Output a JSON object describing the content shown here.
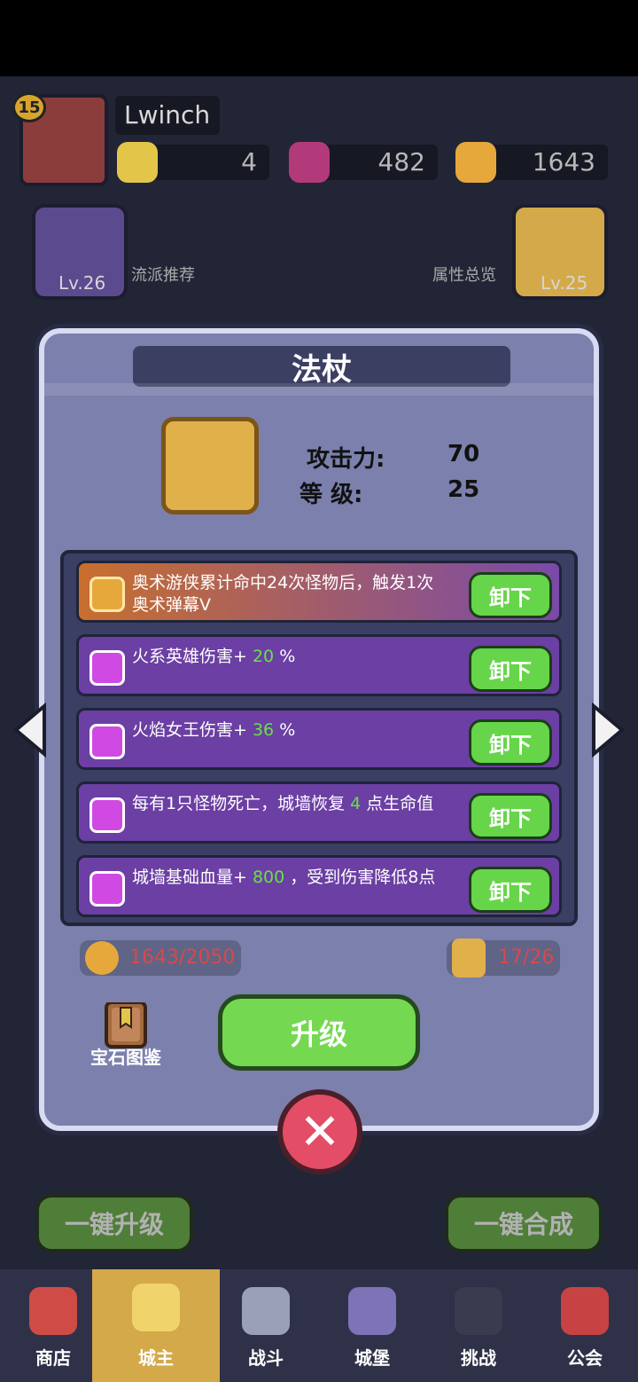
{
  "hud": {
    "level": "15",
    "player_name": "Lwinch",
    "resources": [
      {
        "icon": "gold-gem-icon",
        "value": "4"
      },
      {
        "icon": "purple-gem-icon",
        "value": "482"
      },
      {
        "icon": "coin-icon",
        "value": "1643"
      }
    ]
  },
  "side": {
    "left_card": {
      "level": "Lv.26",
      "label": "流派推荐"
    },
    "right_card": {
      "level": "Lv.25",
      "label": "属性总览"
    }
  },
  "modal": {
    "title": "法杖",
    "stats": {
      "attack_label": "攻击力:",
      "attack_value": "70",
      "level_label": "等  级:",
      "level_value": "25"
    },
    "abilities": [
      {
        "text_prefix": "奥术游侠累计命中24次怪物后，触发1次奥术弹幕V",
        "text_value": "",
        "text_suffix": "",
        "button": "卸下",
        "icon_color": "#e7a83b"
      },
      {
        "text_prefix": "火系英雄伤害+",
        "text_value": "20",
        "text_suffix": "%",
        "button": "卸下",
        "icon_color": "#d049e2"
      },
      {
        "text_prefix": "火焰女王伤害+",
        "text_value": "36",
        "text_suffix": "%",
        "button": "卸下",
        "icon_color": "#d049e2"
      },
      {
        "text_prefix": "每有1只怪物死亡，城墙恢复",
        "text_value": "4",
        "text_suffix": "点生命值",
        "button": "卸下",
        "icon_color": "#d049e2"
      },
      {
        "text_prefix": "城墙基础血量+",
        "text_value": "800",
        "text_suffix": "，受到伤害降低8点",
        "button": "卸下",
        "icon_color": "#d049e2"
      }
    ],
    "resource_left": "1643/2050",
    "resource_right": "17/26",
    "gem_book_label": "宝石图鉴",
    "upgrade_button": "升级"
  },
  "bottom_buttons": {
    "left": "一键升级",
    "right": "一键合成"
  },
  "tabs": [
    "商店",
    "城主",
    "战斗",
    "城堡",
    "挑战",
    "公会"
  ]
}
